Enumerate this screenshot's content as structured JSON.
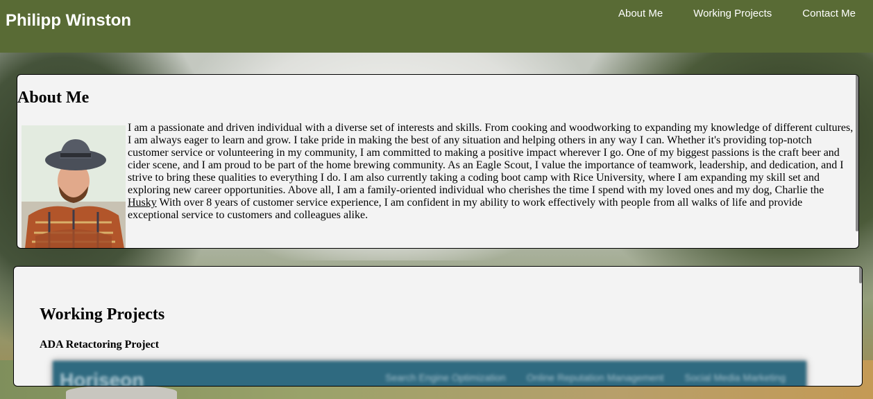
{
  "header": {
    "title": "Philipp Winston",
    "nav": [
      "About Me",
      "Working Projects",
      "Contact Me"
    ],
    "background_color": "#596b35"
  },
  "about": {
    "heading": "About Me",
    "text_before_link": "I am a passionate and driven individual with a diverse set of interests and skills. From cooking and woodworking to expanding my knowledge of different cultures, I am always eager to learn and grow. I take pride in making the best of any situation and helping others in any way I can. Whether it's providing top-notch customer service or volunteering in my community, I am committed to making a positive impact wherever I go. One of my biggest passions is the craft beer and cider scene, and I am proud to be part of the home brewing community. As an Eagle Scout, I value the importance of teamwork, leadership, and dedication, and I strive to bring these qualities to everything I do. I am also currently taking a coding boot camp with Rice University, where I am expanding my skill set and exploring new career opportunities. Above all, I am a family-oriented individual who cherishes the time I spend with my loved ones and my dog, Charlie the ",
    "link_text": "Husky",
    "text_after_link": " With over 8 years of customer service experience, I am confident in my ability to work effectively with people from all walks of life and provide exceptional service to customers and colleagues alike."
  },
  "projects": {
    "heading": "Working Projects",
    "items": [
      {
        "title": "ADA Retactoring Project",
        "preview_brand": "Horiseon",
        "preview_links": [
          "Search Engine Optimization",
          "Online Reputation Management",
          "Social Media Marketing"
        ]
      }
    ]
  }
}
